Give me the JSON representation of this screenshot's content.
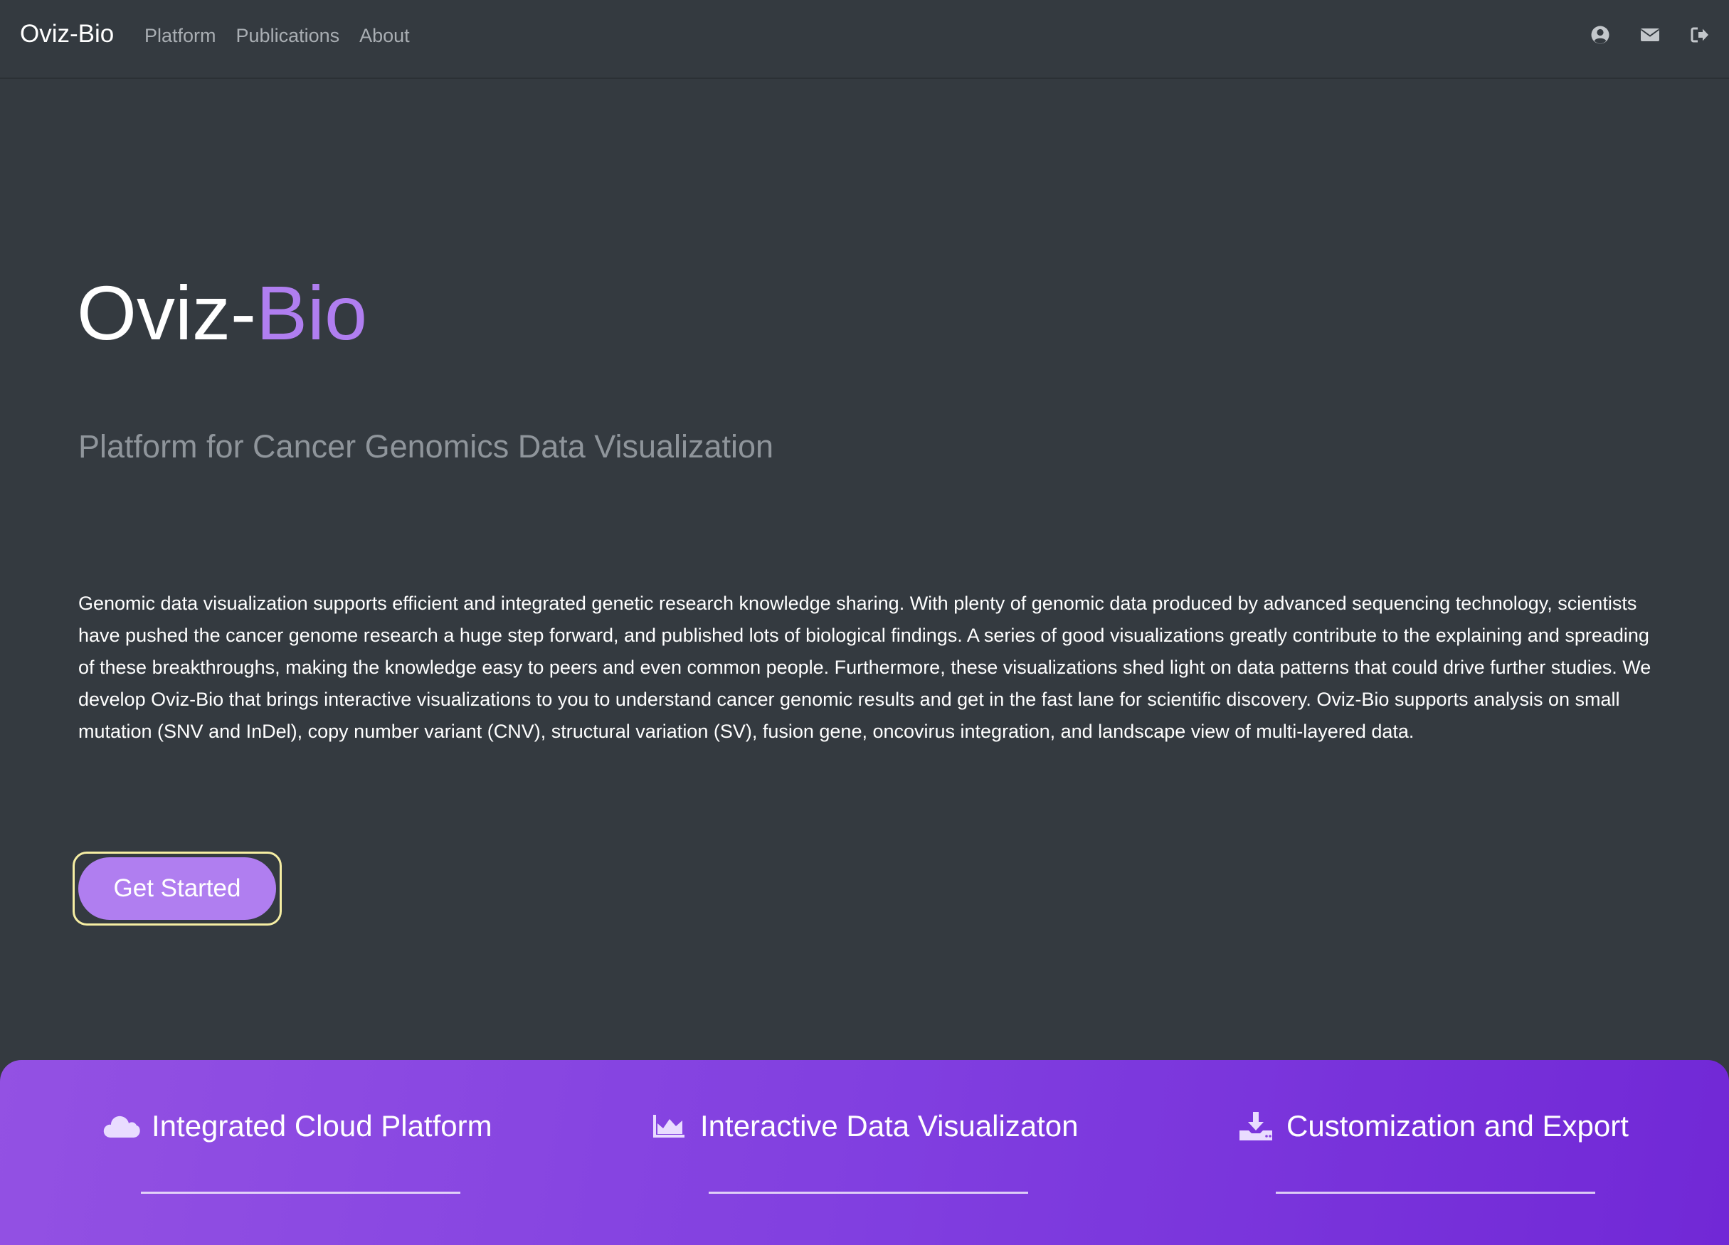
{
  "navbar": {
    "brand": "Oviz-Bio",
    "links": [
      {
        "label": "Platform"
      },
      {
        "label": "Publications"
      },
      {
        "label": "About"
      }
    ],
    "icons": [
      "user-circle-icon",
      "envelope-icon",
      "sign-out-icon"
    ]
  },
  "hero": {
    "title_main": "Oviz-",
    "title_accent": "Bio",
    "subtitle": "Platform for Cancer Genomics Data Visualization",
    "description": "Genomic data visualization supports efficient and integrated genetic research knowledge sharing. With plenty of genomic data produced by advanced sequencing technology, scientists have pushed the cancer genome research a huge step forward, and published lots of biological findings. A series of good visualizations greatly contribute to the explaining and spreading of these breakthroughs, making the knowledge easy to peers and even common people. Furthermore, these visualizations shed light on data patterns that could drive further studies. We develop Oviz-Bio that brings interactive visualizations to you to understand cancer genomic results and get in the fast lane for scientific discovery. Oviz-Bio supports analysis on small mutation (SNV and InDel), copy number variant (CNV), structural variation (SV), fusion gene, oncovirus integration, and landscape view of multi-layered data.",
    "cta_label": "Get Started"
  },
  "features": [
    {
      "label": "Integrated Cloud Platform",
      "icon": "cloud-icon"
    },
    {
      "label": "Interactive Data Visualizaton",
      "icon": "area-chart-icon"
    },
    {
      "label": "Customization and Export",
      "icon": "download-icon"
    }
  ],
  "colors": {
    "background": "#343a40",
    "accent": "#b07ef0",
    "band_start": "#9351e3",
    "band_end": "#7128d6"
  }
}
